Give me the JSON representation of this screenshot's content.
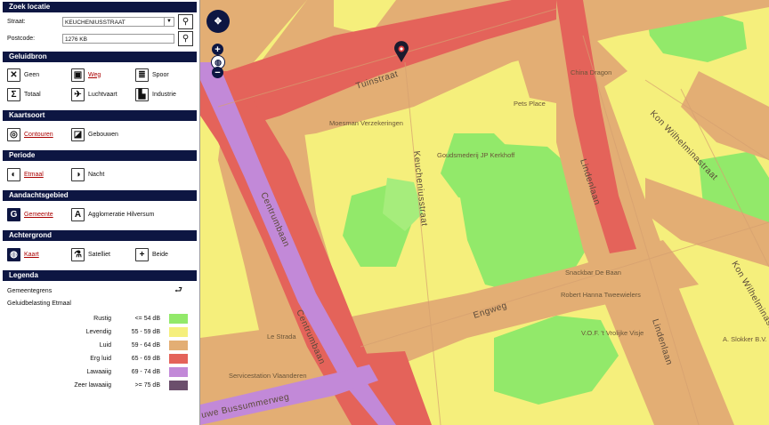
{
  "zoek": {
    "title": "Zoek locatie",
    "straat_label": "Straat:",
    "straat_value": "KEUCHENIUSSTRAAT",
    "postcode_label": "Postcode:",
    "postcode_value": "1276 KB"
  },
  "geluidbron": {
    "title": "Geluidbron",
    "options": [
      "Geen",
      "Weg",
      "Spoor",
      "Totaal",
      "Luchtvaart",
      "Industrie"
    ],
    "selected": "Weg"
  },
  "kaartsoort": {
    "title": "Kaartsoort",
    "options": [
      "Contouren",
      "Gebouwen"
    ],
    "selected": "Contouren"
  },
  "periode": {
    "title": "Periode",
    "options": [
      "Etmaal",
      "Nacht"
    ],
    "selected": "Etmaal"
  },
  "aandachtsgebied": {
    "title": "Aandachtsgebied",
    "options": [
      "Gemeente",
      "Agglomeratie Hilversum"
    ],
    "selected": "Gemeente"
  },
  "achtergrond": {
    "title": "Achtergrond",
    "options": [
      "Kaart",
      "Satelliet",
      "Beide"
    ],
    "selected": "Kaart"
  },
  "legenda": {
    "title": "Legenda",
    "gemeentegrens": "Gemeentegrens",
    "subtitle": "Geluidbelasting Etmaal",
    "items": [
      {
        "name": "Rustig",
        "range": "<= 54 dB",
        "color": "#92e96a"
      },
      {
        "name": "Levendig",
        "range": "55 - 59 dB",
        "color": "#f5ef7c"
      },
      {
        "name": "Luid",
        "range": "59 - 64 dB",
        "color": "#e3ae74"
      },
      {
        "name": "Erg luid",
        "range": "65 - 69 dB",
        "color": "#e4635a"
      },
      {
        "name": "Lawaaiig",
        "range": "69 - 74 dB",
        "color": "#c289d8"
      },
      {
        "name": "Zeer lawaaiig",
        "range": ">= 75 dB",
        "color": "#6b4f6c"
      }
    ]
  },
  "map": {
    "streets": [
      "Tuinstraat",
      "Centrumbaan",
      "Centrumbaan",
      "Keucheniusstraat",
      "Lindenlaan",
      "Lindenlaan",
      "Kon Wilhelminastraat",
      "Kon Wilhelminastraat",
      "Engweg",
      "uwe Bussummerweg"
    ],
    "pois": [
      "China Dragon",
      "Pets Place",
      "Moesman Verzekeringen",
      "Goudsmederij JP Kerkhoff",
      "Snackbar De Baan",
      "Robert Hanna Tweewielers",
      "V.O.F. 't Vrolijke Visje",
      "A. Slokker B.V.",
      "Le Strada",
      "Servicestation Vlaanderen"
    ]
  }
}
